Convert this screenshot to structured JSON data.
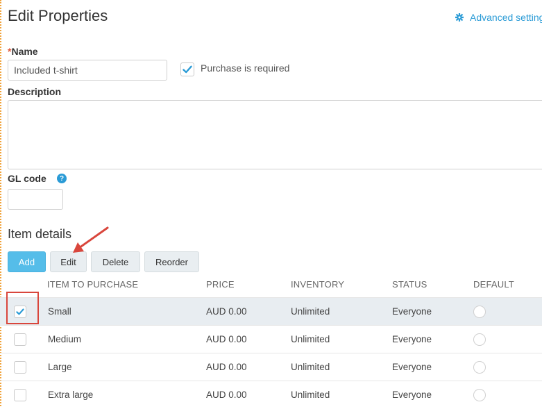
{
  "page": {
    "title": "Edit Properties",
    "advanced_settings_label": "Advanced setting"
  },
  "form": {
    "name_label": "Name",
    "name_required_mark": "*",
    "name_value": "Included t-shirt",
    "purchase_required_label": "Purchase is required",
    "purchase_required_checked": true,
    "description_label": "Description",
    "description_value": "",
    "gl_code_label": "GL code",
    "gl_code_value": ""
  },
  "items": {
    "section_title": "Item details",
    "buttons": {
      "add": "Add",
      "edit": "Edit",
      "delete": "Delete",
      "reorder": "Reorder"
    },
    "columns": {
      "item": "ITEM TO PURCHASE",
      "price": "PRICE",
      "inventory": "INVENTORY",
      "status": "STATUS",
      "default": "DEFAULT"
    },
    "rows": [
      {
        "name": "Small",
        "price": "AUD 0.00",
        "inventory": "Unlimited",
        "status": "Everyone",
        "checked": true
      },
      {
        "name": "Medium",
        "price": "AUD 0.00",
        "inventory": "Unlimited",
        "status": "Everyone",
        "checked": false
      },
      {
        "name": "Large",
        "price": "AUD 0.00",
        "inventory": "Unlimited",
        "status": "Everyone",
        "checked": false
      },
      {
        "name": "Extra large",
        "price": "AUD 0.00",
        "inventory": "Unlimited",
        "status": "Everyone",
        "checked": false
      }
    ]
  },
  "colors": {
    "accent": "#2a9bd6",
    "primary_button": "#55bde9",
    "annotation": "#d9463c"
  },
  "icons": {
    "advanced": "gear-icon",
    "help": "help-icon",
    "check": "checkmark-icon"
  }
}
